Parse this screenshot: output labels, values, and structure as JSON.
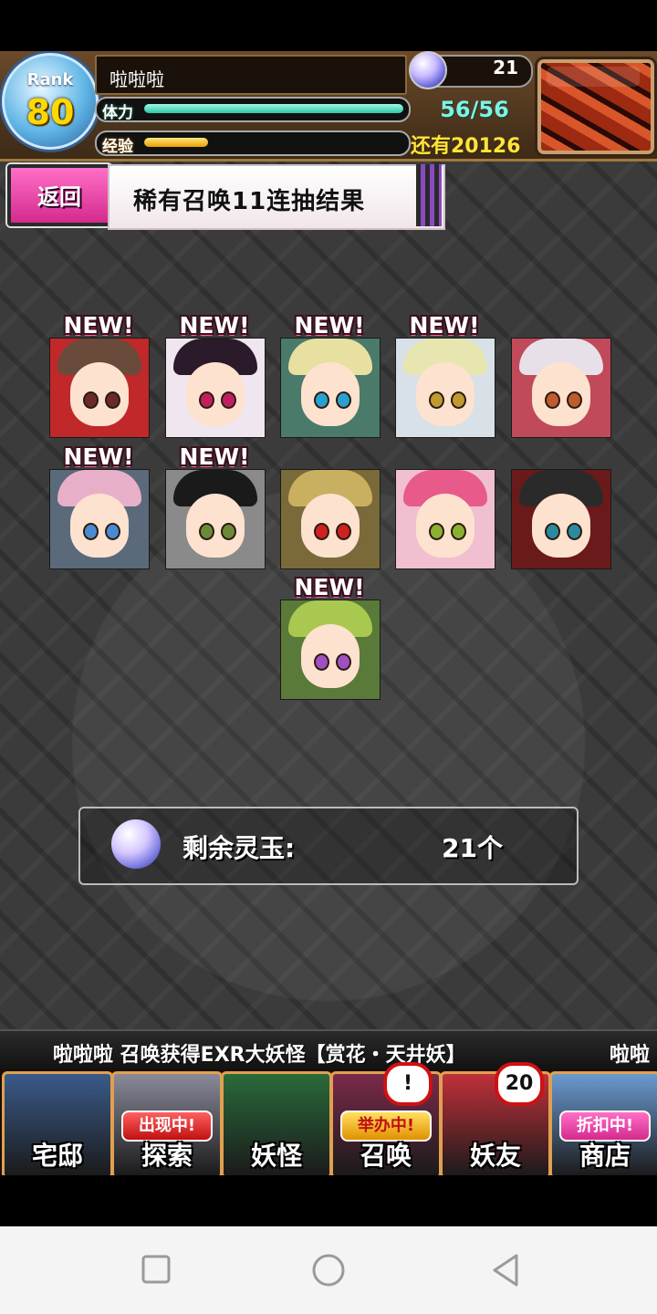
{
  "player": {
    "rank_label": "Rank",
    "rank": "80",
    "name": "啦啦啦",
    "stamina_label": "体力",
    "stamina": "56/56",
    "exp_label": "经验",
    "exp_remaining": "还有20126",
    "gems": "21"
  },
  "header": {
    "back_label": "返回",
    "title": "稀有召唤11连抽结果"
  },
  "results": [
    {
      "new": "NEW!",
      "hair": "#6a4a3a",
      "bg": "#c0282a",
      "eye": "#6a2a2a"
    },
    {
      "new": "NEW!",
      "hair": "#2a1a2a",
      "bg": "#f0e6f0",
      "eye": "#c02060"
    },
    {
      "new": "NEW!",
      "hair": "#e8e0a0",
      "bg": "#4a7a6a",
      "eye": "#2aa0d0"
    },
    {
      "new": "NEW!",
      "hair": "#e8e6b0",
      "bg": "#d8e0e8",
      "eye": "#c09a30"
    },
    {
      "new": "",
      "hair": "#e8e0e8",
      "bg": "#c04a5a",
      "eye": "#c05a30"
    },
    {
      "new": "NEW!",
      "hair": "#e8b0c8",
      "bg": "#5a6a7a",
      "eye": "#4a8ad0"
    },
    {
      "new": "NEW!",
      "hair": "#1a1a1a",
      "bg": "#8a8a8a",
      "eye": "#6a8a3a"
    },
    {
      "new": "",
      "hair": "#c8b060",
      "bg": "#7a6a3a",
      "eye": "#d02020"
    },
    {
      "new": "",
      "hair": "#e85a8a",
      "bg": "#f0c0d0",
      "eye": "#8ab030"
    },
    {
      "new": "",
      "hair": "#2a2a2a",
      "bg": "#6a1a1a",
      "eye": "#2a8aa0"
    },
    {
      "new": "NEW!",
      "hair": "#a8c850",
      "bg": "#5a7a3a",
      "eye": "#a050c0"
    }
  ],
  "remaining": {
    "label": "剩余灵玉:",
    "value": "21个"
  },
  "ticker": {
    "text": "啦啦啦 召唤获得EXR大妖怪【赏花・天井妖】",
    "text_repeat": "啦啦"
  },
  "nav": [
    {
      "label": "宅邸",
      "tag": "",
      "badge": "",
      "bg": "#3a5a8a",
      "tag_style": ""
    },
    {
      "label": "探索",
      "tag": "出现中!",
      "badge": "",
      "bg": "#8a8a9a",
      "tag_style": ""
    },
    {
      "label": "妖怪",
      "tag": "",
      "badge": "",
      "bg": "#2a6a3a",
      "tag_style": ""
    },
    {
      "label": "召唤",
      "tag": "举办中!",
      "badge": "!",
      "bg": "#7a2a4a",
      "tag_style": "green"
    },
    {
      "label": "妖友",
      "tag": "",
      "badge": "20",
      "bg": "#c0303a",
      "tag_style": ""
    },
    {
      "label": "商店",
      "tag": "折扣中!",
      "badge": "",
      "bg": "#6a9ad0",
      "tag_style": "pink"
    }
  ]
}
